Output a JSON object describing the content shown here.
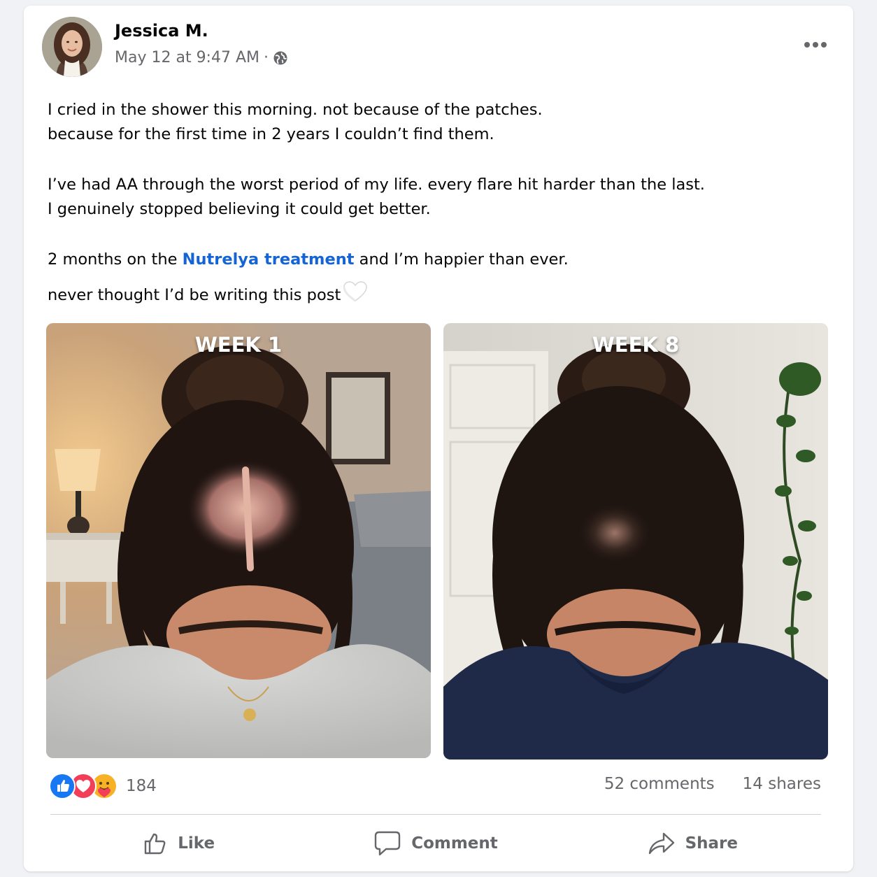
{
  "post": {
    "author": "Jessica M.",
    "timestamp": "May 12 at 9:47 AM",
    "separator": "·",
    "audience_icon": "globe-icon",
    "more_icon": "more-options-icon",
    "body": {
      "line1": "I cried in the shower this morning. not because of the patches.",
      "line2": "because for the first time in 2 years I couldn’t find them.",
      "line3": "I’ve had AA through the worst period of my life. every flare hit harder than the last.",
      "line4": "I genuinely stopped believing it could get better.",
      "line5_before": "2 months on the ",
      "line5_link": "Nutrelya treatment",
      "line5_after": " and I’m happier than ever.",
      "line6": "never thought I’d be writing this post",
      "emoji": "white-heart-icon"
    },
    "photos": [
      {
        "label": "WEEK 1",
        "description_icon": "before-photo"
      },
      {
        "label": "WEEK 8",
        "description_icon": "after-photo"
      }
    ]
  },
  "engagement": {
    "reactions": [
      "like-reaction-icon",
      "love-reaction-icon",
      "care-reaction-icon"
    ],
    "reaction_count": "184",
    "comments": "52 comments",
    "shares": "14 shares"
  },
  "actions": {
    "like": "Like",
    "comment": "Comment",
    "share": "Share"
  },
  "colors": {
    "link": "#1464d6",
    "like_blue": "#1877f2",
    "love_red": "#f33e58",
    "care_yellow": "#f7b125",
    "secondary_text": "#65676b",
    "background": "#f0f2f5"
  }
}
